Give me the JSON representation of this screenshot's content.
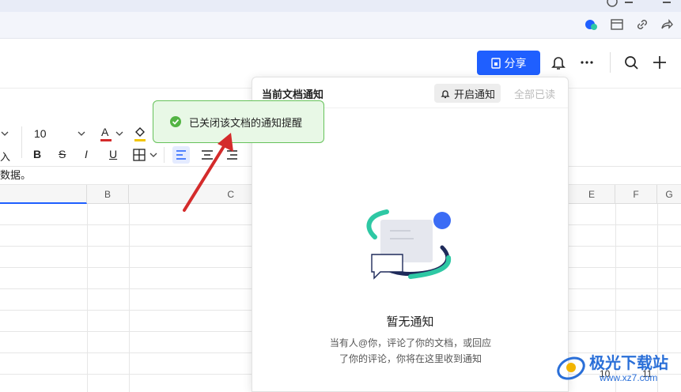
{
  "header": {
    "share_label": "分享"
  },
  "toolbar": {
    "font_size": "10",
    "input_label": "入",
    "bold": "B",
    "strike": "S",
    "italic": "I",
    "underline": "U",
    "font_color_label": "A"
  },
  "formula": {
    "content": "数据。"
  },
  "grid": {
    "columns": [
      "B",
      "C",
      "E",
      "F",
      "G"
    ],
    "row_numbers": [
      "10",
      "11"
    ]
  },
  "panel": {
    "title": "当前文档通知",
    "enable_label": "开启通知",
    "all_read_label": "全部已读",
    "empty_title": "暂无通知",
    "empty_desc_line1": "当有人@你，评论了你的文档，或回应",
    "empty_desc_line2": "了你的评论，你将在这里收到通知"
  },
  "toast": {
    "message": "已关闭该文档的通知提醒"
  },
  "watermark": {
    "name": "极光下载站",
    "url": "www.xz7.com"
  },
  "colors": {
    "accent": "#1f5fff",
    "toast_bg": "#e8f8e6",
    "toast_border": "#66c25a",
    "arrow": "#d42b2b"
  }
}
